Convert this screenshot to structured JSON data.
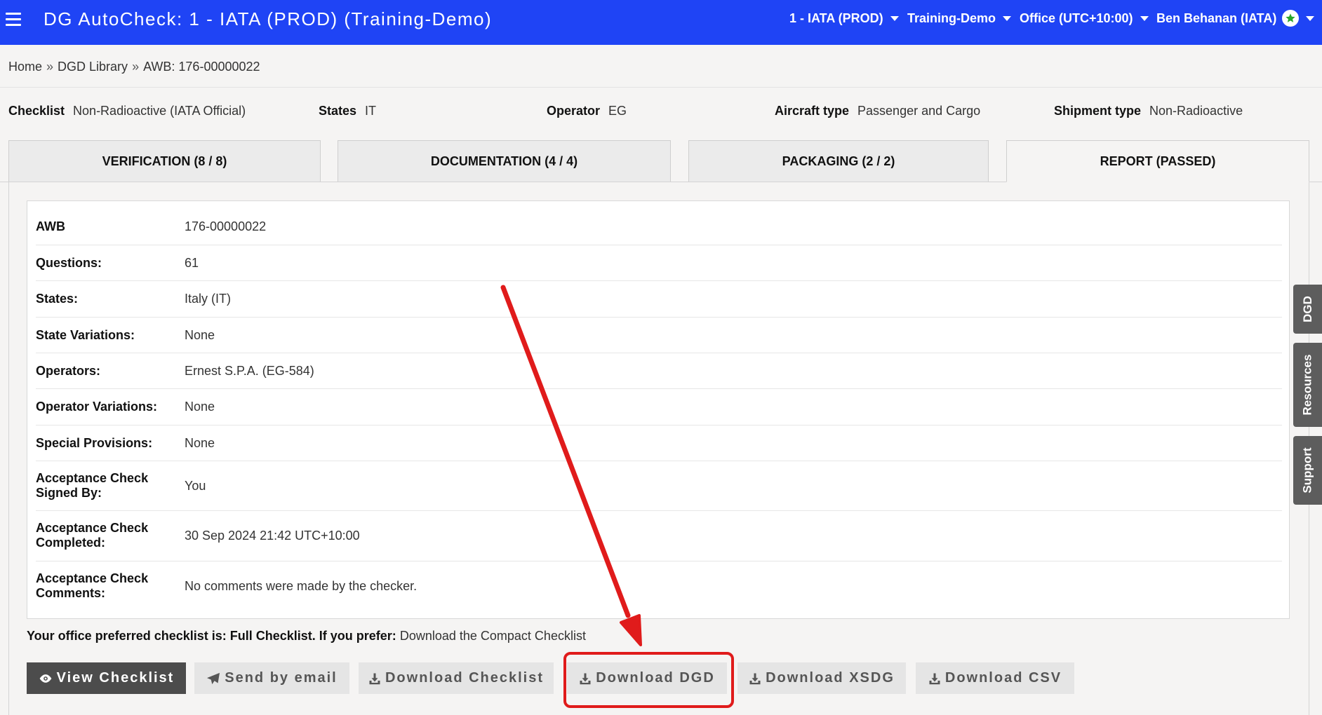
{
  "header": {
    "title": "DG AutoCheck: 1 - IATA (PROD) (Training-Demo)",
    "menus": {
      "org": "1 - IATA (PROD)",
      "env": "Training-Demo",
      "office": "Office (UTC+10:00)",
      "user": "Ben Behanan (IATA)"
    },
    "icons": {
      "menu": "hamburger-icon",
      "user_badge": "star-icon"
    }
  },
  "breadcrumb": {
    "home": "Home",
    "sep": "»",
    "library": "DGD Library",
    "current": "AWB: 176-00000022"
  },
  "meta": {
    "checklist_label": "Checklist",
    "checklist_value": "Non-Radioactive (IATA Official)",
    "states_label": "States",
    "states_value": "IT",
    "operator_label": "Operator",
    "operator_value": "EG",
    "aircraft_label": "Aircraft type",
    "aircraft_value": "Passenger and Cargo",
    "shipment_label": "Shipment type",
    "shipment_value": "Non-Radioactive"
  },
  "tabs": {
    "verification": "VERIFICATION (8 / 8)",
    "documentation": "DOCUMENTATION (4 / 4)",
    "packaging": "PACKAGING (2 / 2)",
    "report": "REPORT (PASSED)"
  },
  "side_tabs": {
    "dgd": "DGD",
    "resources": "Resources",
    "support": "Support"
  },
  "report": {
    "rows": [
      {
        "label": "AWB",
        "value": "176-00000022"
      },
      {
        "label": "Questions:",
        "value": "61"
      },
      {
        "label": "States:",
        "value": "Italy (IT)"
      },
      {
        "label": "State Variations:",
        "value": "None"
      },
      {
        "label": "Operators:",
        "value": "Ernest S.P.A. (EG-584)"
      },
      {
        "label": "Operator Variations:",
        "value": "None"
      },
      {
        "label": "Special Provisions:",
        "value": "None"
      },
      {
        "label": "Acceptance Check Signed By:",
        "value": "You"
      },
      {
        "label": "Acceptance Check Completed:",
        "value": "30 Sep 2024 21:42 UTC+10:00"
      },
      {
        "label": "Acceptance Check Comments:",
        "value": "No comments were made by the checker."
      }
    ]
  },
  "preference": {
    "text": "Your office preferred checklist is: Full Checklist. If you prefer:",
    "link": "Download the Compact Checklist"
  },
  "buttons": {
    "view_checklist": "View Checklist",
    "send_email": "Send by email",
    "download_checklist": "Download Checklist",
    "download_dgd": "Download DGD",
    "download_xsdg": "Download XSDG",
    "download_csv": "Download CSV"
  },
  "annotation": {
    "highlight_color": "#e01b1b"
  }
}
